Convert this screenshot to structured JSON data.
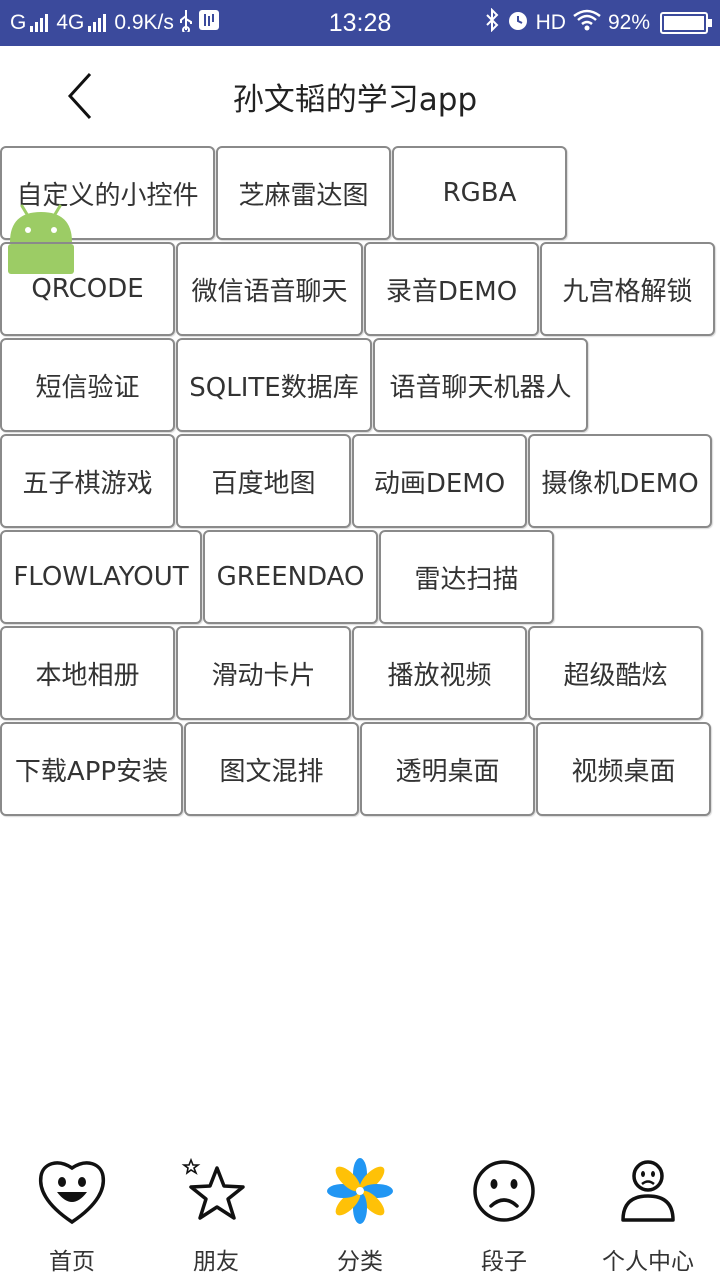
{
  "status_bar": {
    "network_left": "G",
    "network_4g": "4G",
    "speed": "0.9K/s",
    "time": "13:28",
    "hd": "HD",
    "battery": "92%",
    "battery_level": 0.92
  },
  "header": {
    "title": "孙文韬的学习app"
  },
  "tiles": [
    {
      "label": "自定义的小控件"
    },
    {
      "label": "芝麻雷达图"
    },
    {
      "label": "RGBA"
    },
    {
      "label": "QRCODE"
    },
    {
      "label": "微信语音聊天"
    },
    {
      "label": "录音DEMO"
    },
    {
      "label": "九宫格解锁"
    },
    {
      "label": "短信验证"
    },
    {
      "label": "SQLITE数据库"
    },
    {
      "label": "语音聊天机器人"
    },
    {
      "label": "五子棋游戏"
    },
    {
      "label": "百度地图"
    },
    {
      "label": "动画DEMO"
    },
    {
      "label": "摄像机DEMO"
    },
    {
      "label": "FLOWLAYOUT"
    },
    {
      "label": "GREENDAO"
    },
    {
      "label": "雷达扫描"
    },
    {
      "label": "本地相册"
    },
    {
      "label": "滑动卡片"
    },
    {
      "label": "播放视频"
    },
    {
      "label": "超级酷炫"
    },
    {
      "label": "下载APP安装"
    },
    {
      "label": "图文混排"
    },
    {
      "label": "透明桌面"
    },
    {
      "label": "视频桌面"
    }
  ],
  "bottom_nav": {
    "items": [
      {
        "label": "首页",
        "icon": "smiley-heart-icon"
      },
      {
        "label": "朋友",
        "icon": "star-icon"
      },
      {
        "label": "分类",
        "icon": "pinwheel-icon"
      },
      {
        "label": "段子",
        "icon": "sad-face-icon"
      },
      {
        "label": "个人中心",
        "icon": "person-icon"
      }
    ]
  },
  "colors": {
    "status_bar": "#3b4a9c",
    "tile_border": "#8a8a8a",
    "android_green": "#8bc34a",
    "pinwheel_blue": "#2196f3",
    "pinwheel_yellow": "#ffc107"
  }
}
